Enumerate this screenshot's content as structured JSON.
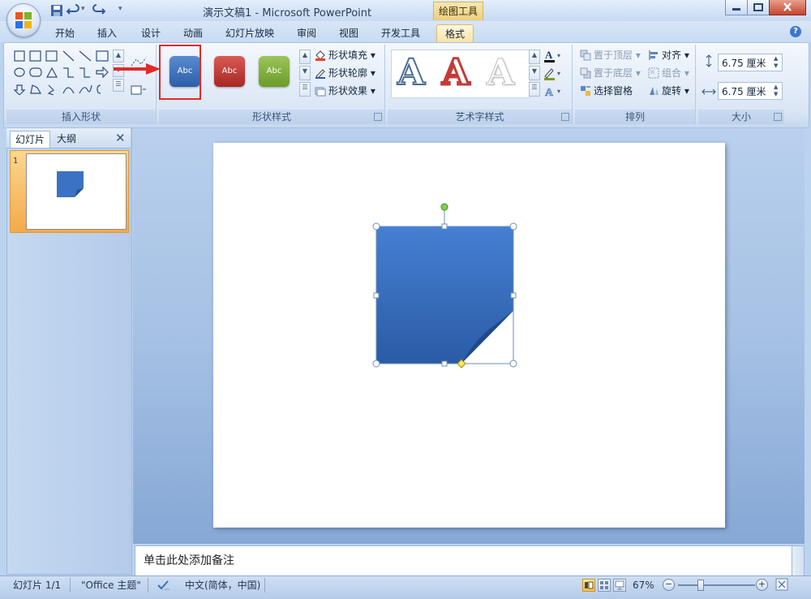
{
  "window": {
    "title": "演示文稿1 - Microsoft PowerPoint",
    "contextual_tab": "绘图工具"
  },
  "tabs": [
    "开始",
    "插入",
    "设计",
    "动画",
    "幻灯片放映",
    "审阅",
    "视图",
    "开发工具",
    "格式"
  ],
  "active_tab": "格式",
  "groups": {
    "insert_shapes": {
      "label": "插入形状"
    },
    "shape_styles": {
      "label": "形状样式",
      "swatches": [
        {
          "text": "Abc",
          "color": "#3f73b9",
          "selected": true
        },
        {
          "text": "Abc",
          "color": "#c23a36",
          "selected": false
        },
        {
          "text": "Abc",
          "color": "#7fae3c",
          "selected": false
        }
      ],
      "fill": "形状填充",
      "outline": "形状轮廓",
      "effects": "形状效果"
    },
    "wordart": {
      "label": "艺术字样式",
      "letters": [
        "A",
        "A",
        "A"
      ]
    },
    "arrange": {
      "label": "排列",
      "bring_front": "置于顶层",
      "send_back": "置于底层",
      "selection_pane": "选择窗格",
      "align": "对齐",
      "group": "组合",
      "rotate": "旋转"
    },
    "size": {
      "label": "大小",
      "height": "6.75 厘米",
      "width": "6.75 厘米"
    }
  },
  "slides_pane": {
    "tab_slides": "幻灯片",
    "tab_outline": "大纲",
    "close": "✕",
    "slide_number": "1"
  },
  "notes": {
    "placeholder": "单击此处添加备注"
  },
  "status": {
    "slide": "幻灯片 1/1",
    "theme": "\"Office 主题\"",
    "language": "中文(简体，中国)",
    "zoom": "67%",
    "zoom_level": 0.67
  },
  "colors": {
    "shape_fill": "#3b72c4",
    "highlight": "#e02a2a",
    "accent": "#f7d27a"
  }
}
